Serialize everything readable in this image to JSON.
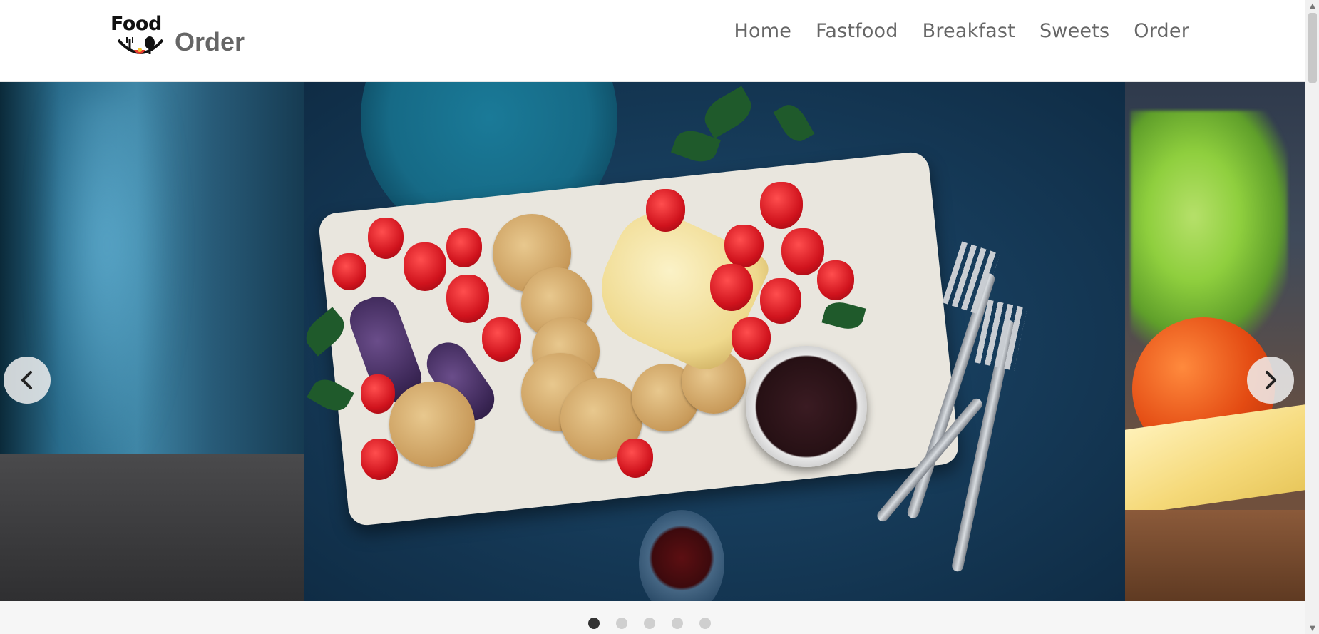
{
  "brand": {
    "logo_word": "Food",
    "logo_suffix": "Order"
  },
  "nav": {
    "items": [
      {
        "label": "Home"
      },
      {
        "label": "Fastfood"
      },
      {
        "label": "Breakfast"
      },
      {
        "label": "Sweets"
      },
      {
        "label": "Order"
      }
    ]
  },
  "carousel": {
    "current_slide": 1,
    "total_slides": 5,
    "prev_icon": "chevron-left-icon",
    "next_icon": "chevron-right-icon"
  },
  "colors": {
    "nav_text": "#666666",
    "indicator_active": "#333333",
    "indicator_inactive": "#cfcfcf"
  }
}
